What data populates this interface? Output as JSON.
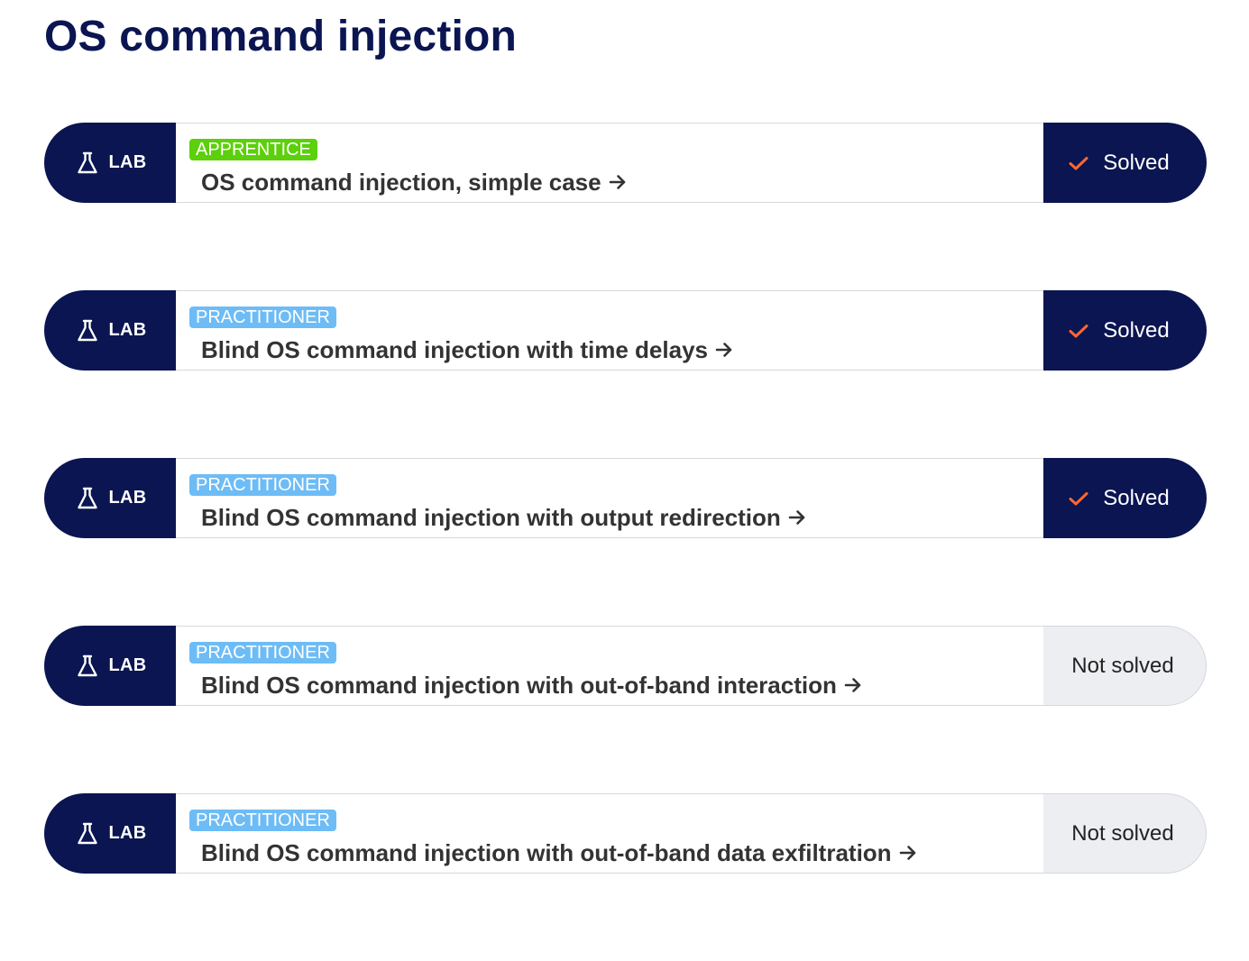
{
  "page_title": "OS command injection",
  "colors": {
    "navy": "#0a1551",
    "apprentice": "#5bd00b",
    "practitioner": "#6dbcf6",
    "check": "#ff6633",
    "not_solved_bg": "#eceef1"
  },
  "labs": [
    {
      "badge_label": "LAB",
      "badge_icon": "flask-icon",
      "level": "APPRENTICE",
      "title": "OS command injection, simple case",
      "status": "Solved",
      "solved": true
    },
    {
      "badge_label": "LAB",
      "badge_icon": "flask-icon",
      "level": "PRACTITIONER",
      "title": "Blind OS command injection with time delays",
      "status": "Solved",
      "solved": true
    },
    {
      "badge_label": "LAB",
      "badge_icon": "flask-icon",
      "level": "PRACTITIONER",
      "title": "Blind OS command injection with output redirection",
      "status": "Solved",
      "solved": true
    },
    {
      "badge_label": "LAB",
      "badge_icon": "flask-icon",
      "level": "PRACTITIONER",
      "title": "Blind OS command injection with out-of-band interaction",
      "status": "Not solved",
      "solved": false
    },
    {
      "badge_label": "LAB",
      "badge_icon": "flask-icon",
      "level": "PRACTITIONER",
      "title": "Blind OS command injection with out-of-band data exfiltration",
      "status": "Not solved",
      "solved": false
    }
  ]
}
